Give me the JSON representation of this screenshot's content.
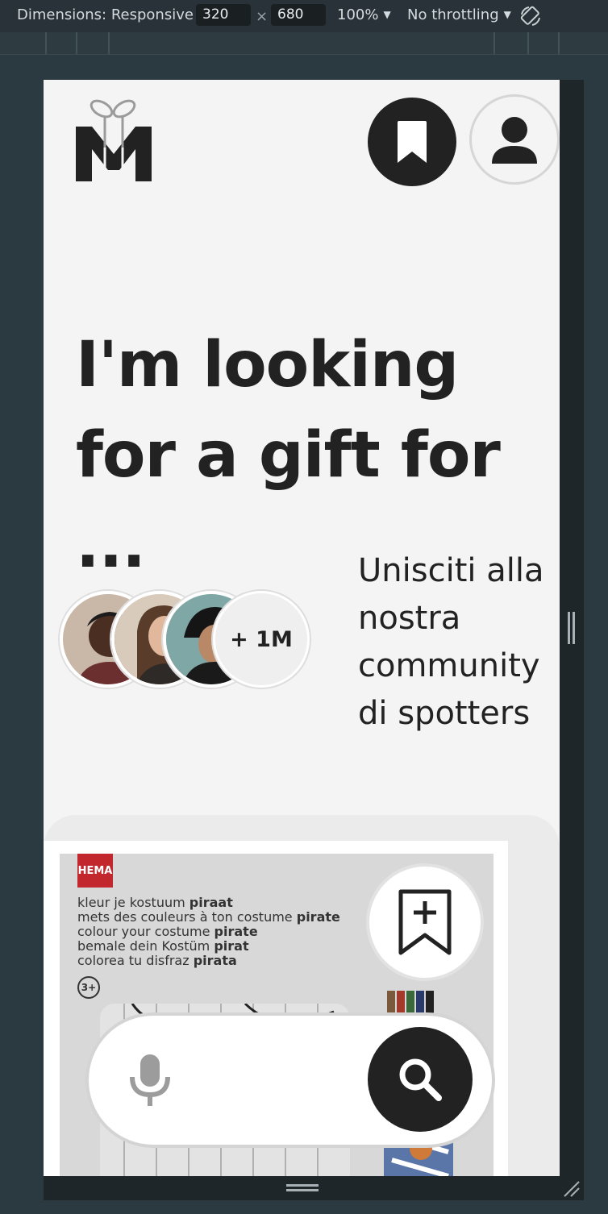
{
  "devtools": {
    "dimensions_label": "Dimensions: Responsive",
    "width_value": "320",
    "times_sign": "×",
    "height_value": "680",
    "zoom": "100%",
    "throttling": "No throttling",
    "caret": "▼"
  },
  "header": {
    "logo_icon": "gift-logo-icon",
    "bookmark_icon": "bookmark-icon",
    "profile_icon": "user-icon"
  },
  "hero": {
    "headline_line1": "I'm looking",
    "headline_line2": "for a gift for ..."
  },
  "community": {
    "member_count": "+ 1M",
    "text_line1": "Unisciti alla",
    "text_line2": "nostra",
    "text_line3": "community",
    "text_line4": "di spotters"
  },
  "product": {
    "brand": "HEMA",
    "lines": [
      [
        "kleur je kostuum ",
        "piraat"
      ],
      [
        "mets des couleurs à ton costume ",
        "pirate"
      ],
      [
        "colour your costume ",
        "pirate"
      ],
      [
        "bemale dein Kostüm ",
        "pirat"
      ],
      [
        "colorea tu disfraz ",
        "pirata"
      ]
    ],
    "age": "3+"
  },
  "search": {
    "mic_icon": "microphone-icon",
    "search_icon": "search-icon",
    "save_icon": "bookmark-plus-icon"
  },
  "colors": {
    "accent": "#222222",
    "page_bg": "#f4f4f4",
    "hema_red": "#c2272d"
  }
}
